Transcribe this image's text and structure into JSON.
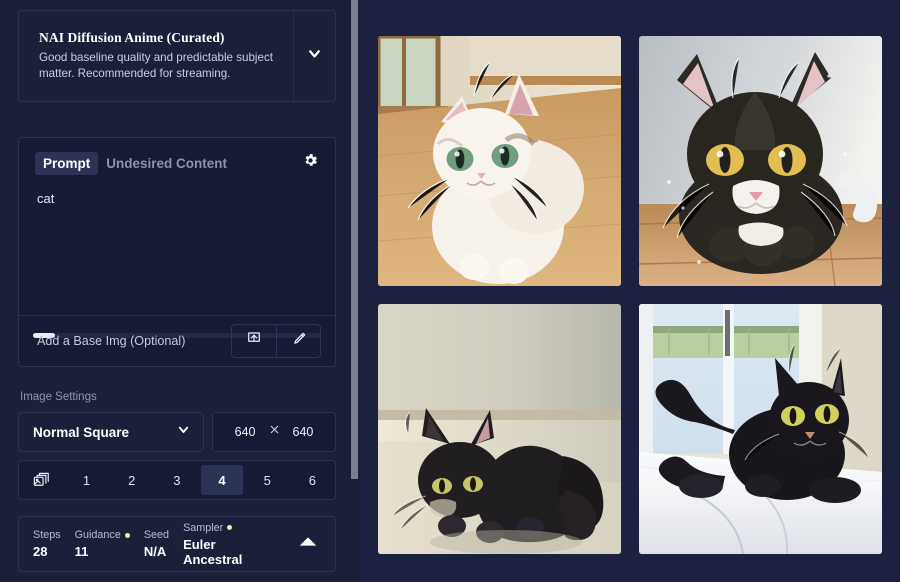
{
  "app": {
    "background_color": "#12152b",
    "panel_color": "#1b2039",
    "accent_color": "#2c3357",
    "dot_color": "#f2edb0"
  },
  "sidebar": {
    "model": {
      "title": "NAI Diffusion Anime (Curated)",
      "description": "Good baseline quality and predictable subject matter. Recommended for streaming.",
      "chevron_icon": "chevron-down-icon"
    },
    "prompt": {
      "tabs": [
        {
          "label": "Prompt",
          "active": true
        },
        {
          "label": "Undesired Content",
          "active": false
        }
      ],
      "settings_icon": "gear-icon",
      "value": "cat",
      "placeholder": "",
      "base_image": {
        "label": "Add a Base Img (Optional)",
        "upload_icon": "upload-icon",
        "edit_icon": "pencil-icon"
      }
    },
    "image_settings": {
      "section_label": "Image Settings",
      "aspect": {
        "value": "Normal Square",
        "chevron_icon": "chevron-down-icon"
      },
      "width": "640",
      "separator": "×",
      "height": "640",
      "count": {
        "stack_icon": "image-stack-icon",
        "options": [
          "1",
          "2",
          "3",
          "4",
          "5",
          "6"
        ],
        "selected": "4"
      }
    },
    "params": {
      "items": [
        {
          "label": "Steps",
          "value": "28",
          "dot": false
        },
        {
          "label": "Guidance",
          "value": "11",
          "dot": true
        },
        {
          "label": "Seed",
          "value": "N/A",
          "dot": false
        },
        {
          "label": "Sampler",
          "value": "Euler Ancestral",
          "dot": true
        }
      ],
      "collapse_icon": "chevron-up-icon"
    }
  },
  "gallery": {
    "images": [
      {
        "alt": "white cream cat with green eyes sitting on wooden floor by a window",
        "theme": "white-cat-window"
      },
      {
        "alt": "black and white tuxedo cat with yellow eyes lying down on wooden floor",
        "theme": "tuxedo-cat"
      },
      {
        "alt": "black cat crouching on a beige floor against a pale wall",
        "theme": "black-cat-floor"
      },
      {
        "alt": "black cat with yellow eyes sitting on a white bed near a bright window",
        "theme": "black-cat-bed"
      }
    ]
  }
}
